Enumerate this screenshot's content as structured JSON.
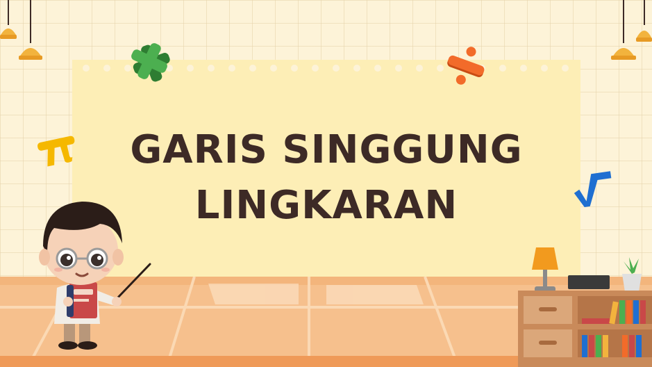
{
  "slide": {
    "title_line1": "GARIS SINGGUNG",
    "title_line2": "LINGKARAN"
  },
  "colors": {
    "background": "#fdf3d8",
    "board": "#fdeeb6",
    "title_text": "#3d2a26",
    "floor": "#f6c08d",
    "times_symbol": "#4caf50",
    "divide_symbol": "#f26b2a",
    "pi_symbol": "#f5b800",
    "root_symbol": "#1f6fd1"
  },
  "icons": [
    "times-icon",
    "divide-icon",
    "pi-icon",
    "square-root-icon",
    "ceiling-lamp-icon",
    "teacher-character",
    "table-lamp-icon",
    "bookshelf-icon",
    "potted-plant-icon"
  ]
}
